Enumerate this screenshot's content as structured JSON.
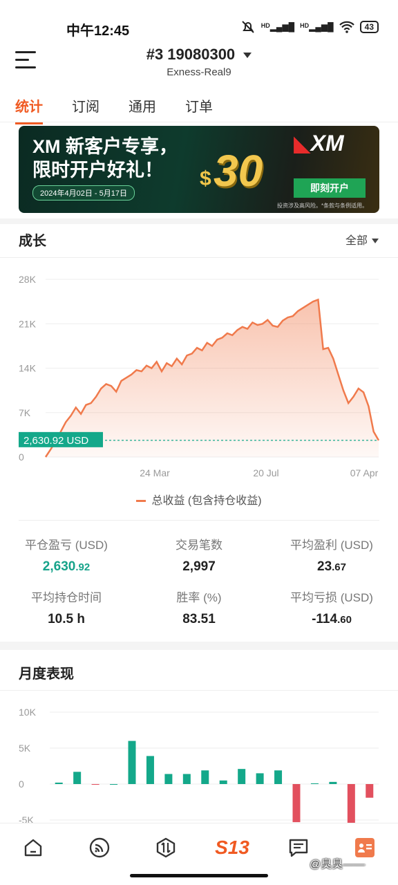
{
  "status": {
    "time": "中午12:45",
    "battery": "43",
    "signal1": "HD",
    "signal2": "HD"
  },
  "header": {
    "title": "#3  19080300",
    "subtitle": "Exness-Real9"
  },
  "tabs": [
    {
      "label": "统计",
      "active": true
    },
    {
      "label": "订阅",
      "active": false
    },
    {
      "label": "通用",
      "active": false
    },
    {
      "label": "订单",
      "active": false
    }
  ],
  "banner": {
    "line1": "XM 新客户专享，",
    "line2": "限时开户好礼！",
    "date": "2024年4月02日 - 5月17日",
    "dollar": "$",
    "amount": "30",
    "logo": "XM",
    "cta": "即刻开户",
    "risk": "投资涉及高风险。*条款与条例适用。"
  },
  "growth": {
    "title": "成长",
    "filter": "全部",
    "current_value_label": "2,630.92 USD",
    "legend": "总收益 (包含持仓收益)"
  },
  "chart_data": [
    {
      "type": "area",
      "y_ticks": [
        "28K",
        "21K",
        "14K",
        "7K",
        "0"
      ],
      "x_ticks": [
        "24 Mar",
        "20 Jul",
        "07 Apr"
      ],
      "ylim": [
        0,
        28000
      ],
      "reference_line": 2630.92,
      "color": "#f07a4c",
      "series": [
        {
          "values": [
            0,
            1200,
            2500,
            4000,
            5500,
            6500,
            7800,
            6800,
            8200,
            8500,
            9500,
            10800,
            11500,
            11200,
            10300,
            12000,
            12500,
            13000,
            13700,
            13500,
            14400,
            14000,
            15000,
            13500,
            14800,
            14300,
            15500,
            14600,
            16000,
            16300,
            17200,
            16800,
            18000,
            17500,
            18500,
            18800,
            19500,
            19200,
            20000,
            20500,
            20200,
            21200,
            20800,
            21000,
            21600,
            20700,
            20500,
            21500,
            22000,
            22200,
            23000,
            23500,
            24000,
            24500,
            24800,
            17000,
            17200,
            15500,
            13000,
            10500,
            8500,
            9500,
            10800,
            10200,
            8000,
            4000,
            2631
          ]
        }
      ]
    },
    {
      "type": "bar",
      "title": "月度表现",
      "y_ticks": [
        "10K",
        "5K",
        "0",
        "-5K"
      ],
      "ylim": [
        -5000,
        10000
      ],
      "positive_color": "#14a88a",
      "negative_color": "#e2505e",
      "values": [
        200,
        1700,
        -100,
        0,
        6000,
        3900,
        1400,
        1400,
        1900,
        500,
        2100,
        1500,
        1900,
        -5300,
        100,
        300,
        -5600,
        -1900
      ]
    }
  ],
  "stats": [
    {
      "label": "平仓盈亏 (USD)",
      "int": "2,630",
      "dec": ".92",
      "green": true
    },
    {
      "label": "交易笔数",
      "int": "2,997",
      "dec": "",
      "green": false
    },
    {
      "label": "平均盈利 (USD)",
      "int": "23",
      "dec": ".67",
      "green": false
    },
    {
      "label": "平均持仓时间",
      "int": "10.5 h",
      "dec": "",
      "green": false
    },
    {
      "label": "胜率 (%)",
      "int": "83.51",
      "dec": "",
      "green": false
    },
    {
      "label": "平均亏损 (USD)",
      "int": "-114",
      "dec": ".60",
      "green": false
    }
  ],
  "monthly": {
    "title": "月度表现"
  },
  "nav": {
    "items": [
      "home-icon",
      "signal-feed-icon",
      "trade-icon",
      "s13-logo-icon",
      "chat-icon",
      "profile-icon"
    ],
    "logo_text": "S13",
    "accent": "#f05a22"
  },
  "watermark": "@臭臭——"
}
